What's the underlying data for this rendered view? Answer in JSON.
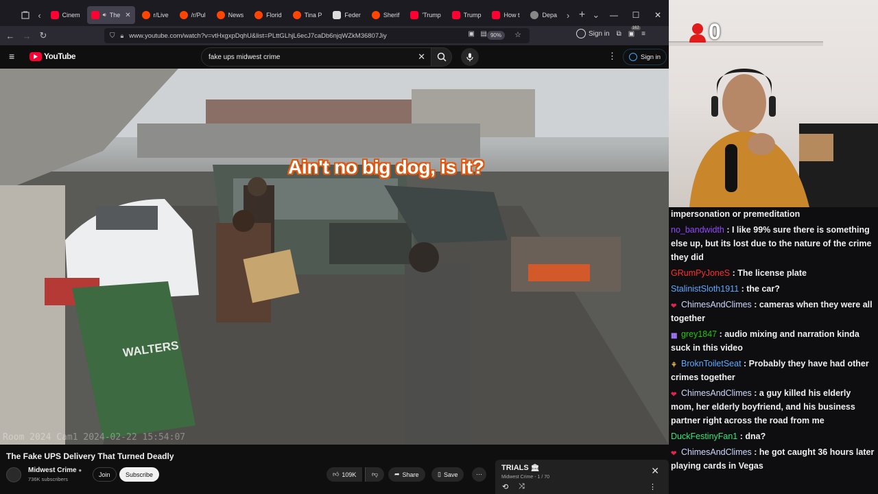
{
  "browser": {
    "tabs": [
      {
        "label": "Cinem",
        "favicon": "youtube",
        "active": false
      },
      {
        "label": "The",
        "favicon": "youtube",
        "active": true
      },
      {
        "label": "r/Live",
        "favicon": "reddit",
        "active": false
      },
      {
        "label": "/r/Pul",
        "favicon": "reddit",
        "active": false
      },
      {
        "label": "News",
        "favicon": "reddit",
        "active": false
      },
      {
        "label": "Florid",
        "favicon": "reddit",
        "active": false
      },
      {
        "label": "Tina P",
        "favicon": "reddit",
        "active": false
      },
      {
        "label": "Feder",
        "favicon": "white",
        "active": false
      },
      {
        "label": "Sherif",
        "favicon": "reddit",
        "active": false
      },
      {
        "label": "'Trump",
        "favicon": "youtube",
        "active": false
      },
      {
        "label": "Trump",
        "favicon": "youtube",
        "active": false
      },
      {
        "label": "How t",
        "favicon": "youtube",
        "active": false
      },
      {
        "label": "Depa",
        "favicon": "gray",
        "active": false
      }
    ],
    "url": "www.youtube.com/watch?v=vtHxgxpDqhU&list=PLttGLhjL6ecJ7caDb6njqWZkM36807Jiy",
    "zoom": "90%",
    "signin_label": "Sign in",
    "extensions_badge": "162"
  },
  "youtube": {
    "logo_text": "YouTube",
    "search_value": "fake ups midwest crime",
    "signin_label": "Sign in",
    "video": {
      "caption": "Ain't no big dog, is it?",
      "camera_timestamp": "Room 2024 Cam1 2024-02-22 15:54:07"
    },
    "title": "The Fake UPS Delivery That Turned Deadly",
    "channel": {
      "name": "Midwest Crime",
      "subscribers": "736K subscribers",
      "join_label": "Join",
      "subscribe_label": "Subscribe"
    },
    "actions": {
      "likes": "109K",
      "share_label": "Share",
      "save_label": "Save"
    },
    "playlist": {
      "title": "TRIALS",
      "subtitle": "Midwest Crime - 1 / 70"
    }
  },
  "stream": {
    "viewer_count": "0",
    "chat": [
      {
        "user": "",
        "text": "impersonation or premeditation",
        "color": "#efeff1",
        "badge": ""
      },
      {
        "user": "no_bandwidth",
        "text": "I like 99% sure there is something else up, but its lost due to the nature of the crime they did",
        "color": "#9147ff",
        "badge": ""
      },
      {
        "user": "GRumPyJoneS",
        "text": "The license plate",
        "color": "#ff2d2d",
        "badge": ""
      },
      {
        "user": "StalinistSloth1911",
        "text": "the car?",
        "color": "#5fa8ff",
        "badge": ""
      },
      {
        "user": "ChimesAndClimes",
        "text": "cameras when they were all together",
        "color": "#cfd8ff",
        "badge": "heart"
      },
      {
        "user": "grey1847",
        "text": "audio mixing and narration kinda suck in this video",
        "color": "#1ec700",
        "badge": "sub"
      },
      {
        "user": "BroknToiletSeat",
        "text": "Probably they have had other crimes together",
        "color": "#5fa8ff",
        "badge": "leaf"
      },
      {
        "user": "ChimesAndClimes",
        "text": "a guy killed his elderly mom, her elderly boyfriend, and his business partner right across the road from me",
        "color": "#cfd8ff",
        "badge": "heart"
      },
      {
        "user": "DuckFestinyFan1",
        "text": "dna?",
        "color": "#2ee87a",
        "badge": ""
      },
      {
        "user": "ChimesAndClimes",
        "text": "he got caught 36 hours later playing cards in Vegas",
        "color": "#cfd8ff",
        "badge": "heart"
      }
    ]
  }
}
